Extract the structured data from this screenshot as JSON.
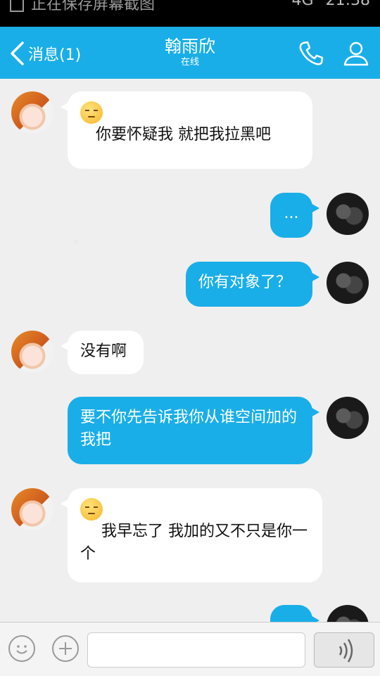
{
  "status_bar": {
    "notification": "正在保存屏幕截图",
    "network": "4G",
    "time": "21:38"
  },
  "header": {
    "back_label": "消息(1)",
    "contact_name": "翰雨欣",
    "contact_status": "在线",
    "accent_color": "#19aee8"
  },
  "messages": [
    {
      "from": "them",
      "emoji": "relieved-face",
      "text": "你要怀疑我   就把我拉黑吧"
    },
    {
      "from": "me",
      "text": "..."
    },
    {
      "from": "me",
      "text": "你有对象了？"
    },
    {
      "from": "them",
      "text": "没有啊"
    },
    {
      "from": "me",
      "text": "要不你先告诉我你从谁空间加的我把"
    },
    {
      "from": "them",
      "emoji": "relieved-face",
      "text": "我早忘了   我加的又不只是你一个"
    }
  ],
  "input": {
    "placeholder": ""
  }
}
